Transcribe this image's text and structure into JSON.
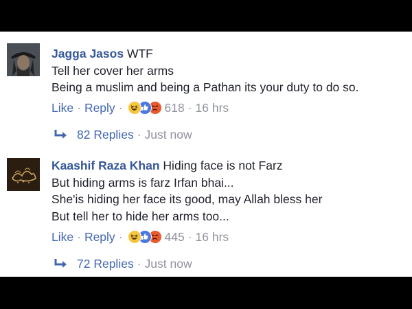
{
  "comments": [
    {
      "author": "Jagga Jasos",
      "lines": [
        "WTF",
        "Tell her cover her arms",
        "Being a muslim and being a Pathan its your duty to do so."
      ],
      "like_label": "Like",
      "reply_label": "Reply",
      "reactions": [
        "haha-icon",
        "like-icon",
        "angry-icon"
      ],
      "reaction_count": "618",
      "time": "16 hrs",
      "replies_label": "82 Replies",
      "replies_time": "Just now"
    },
    {
      "author": "Kaashif Raza Khan",
      "lines": [
        "Hiding face is not Farz",
        "But hiding arms is farz Irfan bhai...",
        "She'is hiding her face its good, may Allah bless her",
        "But tell her to hide her arms too..."
      ],
      "like_label": "Like",
      "reply_label": "Reply",
      "reactions": [
        "haha-icon",
        "like-icon",
        "angry-icon"
      ],
      "reaction_count": "445",
      "time": "16 hrs",
      "replies_label": "72 Replies",
      "replies_time": "Just now"
    }
  ],
  "colors": {
    "name": "#365899",
    "link": "#4267b2",
    "meta": "#90949c",
    "text": "#1d2129"
  }
}
